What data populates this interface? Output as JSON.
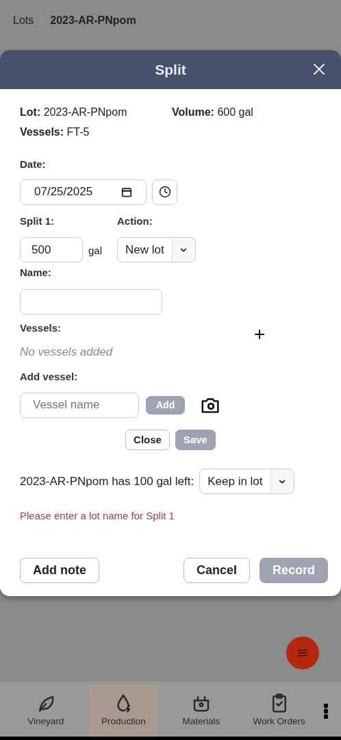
{
  "breadcrumb": [
    {
      "label": "Lots",
      "current": false
    },
    {
      "label": "2023-AR-PNpom",
      "current": true
    }
  ],
  "modal": {
    "title": "Split",
    "summary": {
      "lot_label": "Lot:",
      "lot": "2023-AR-PNpom",
      "volume_label": "Volume:",
      "volume": "600 gal",
      "vessels_label": "Vessels:",
      "vessels": "FT-5"
    },
    "date": {
      "label": "Date:",
      "value": "07/25/2025"
    },
    "split": {
      "label": "Split 1:",
      "amount": "500",
      "unit": "gal",
      "action_label": "Action:",
      "action": "New lot",
      "name_label": "Name:",
      "vessels_label": "Vessels:",
      "vessels_empty": "No vessels added",
      "add_vessel_label": "Add vessel:",
      "vessel_placeholder": "Vessel name",
      "add_button": {
        "label": "Add",
        "disabled": true
      },
      "close_button": {
        "label": "Close",
        "disabled": false
      },
      "save_button": {
        "label": "Save",
        "disabled": true
      }
    },
    "remainder": {
      "text": "2023-AR-PNpom has 100 gal left:",
      "action": "Keep in lot"
    },
    "error": "Please enter a lot name for Split 1",
    "footer": [
      {
        "label": "Add note",
        "disabled": false
      },
      {
        "label": "Cancel",
        "disabled": false
      },
      {
        "label": "Record",
        "disabled": true
      }
    ]
  },
  "nav": [
    {
      "label": "Vineyard",
      "kind": "leaf",
      "selected": false
    },
    {
      "label": "Production",
      "kind": "drop",
      "selected": true
    },
    {
      "label": "Materials",
      "kind": "basket",
      "selected": false
    },
    {
      "label": "Work Orders",
      "kind": "clipboard",
      "selected": false
    }
  ]
}
